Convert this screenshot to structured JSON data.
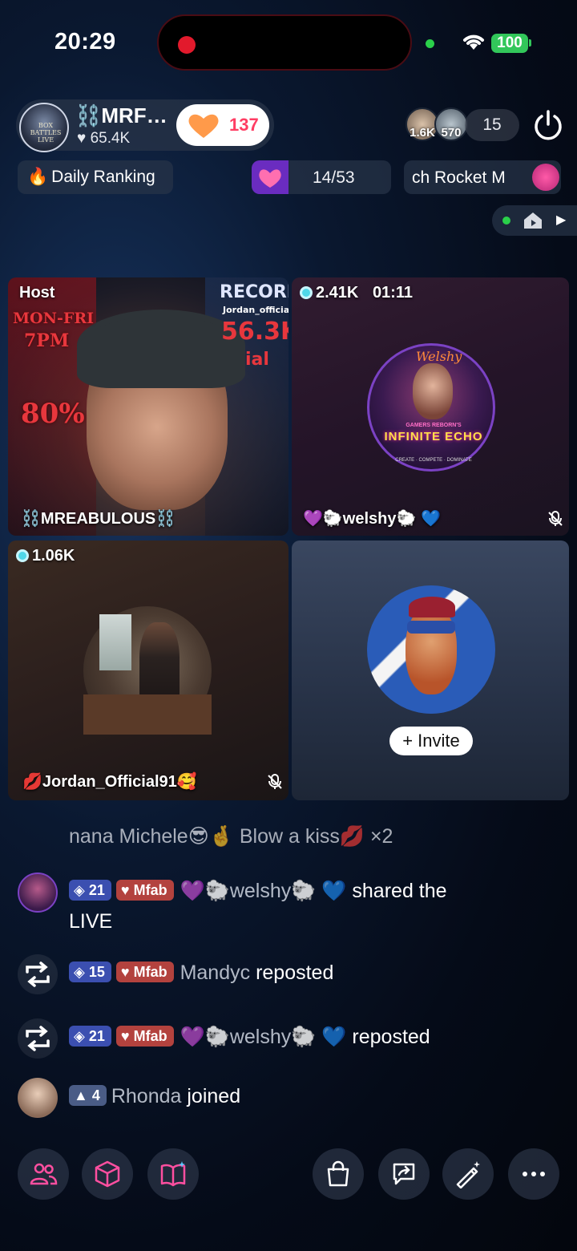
{
  "status_bar": {
    "time": "20:29",
    "battery": "100"
  },
  "host": {
    "name": "⛓️MRF…",
    "likes": "65.4K",
    "heart_count": "137",
    "avatar_text": "BOX BATTLES LIVE"
  },
  "viewers": {
    "avatar1_count": "1.6K",
    "avatar2_count": "570",
    "total": "15"
  },
  "ranking": {
    "label": "Daily Ranking",
    "goal_progress": "14/53",
    "rocket_text": "ch Rocket  M"
  },
  "tiles": {
    "host": {
      "label": "Host",
      "name": "⛓️MREABULOUS⛓️",
      "banner_left": [
        "MON-FRI",
        "7PM",
        "80%"
      ],
      "banner_right": [
        "RECORD",
        "Jordan_official",
        "56.3K",
        "ial"
      ]
    },
    "welshy": {
      "score": "2.41K",
      "timer": "01:11",
      "name": "💜🐑welshy🐑 💙",
      "logo_top": "Welshy",
      "logo_sub": "GAMERS REBORN'S",
      "logo_main": "INFINITE ECHO",
      "logo_tag": "CREATE · COMPETE · DOMINATE"
    },
    "jordan": {
      "score": "1.06K",
      "name": "💋Jordan_Official91🥰"
    },
    "invite": {
      "button": "+ Invite"
    }
  },
  "gift_line": "nana Michele😎🤞  Blow a kiss💋 ×2",
  "comments": [
    {
      "level": "21",
      "fan": "Mfab",
      "name": "💜🐑welshy🐑 💙",
      "action": "shared the",
      "action2": "LIVE"
    },
    {
      "level": "15",
      "fan": "Mfab",
      "name": "Mandyc",
      "action": "reposted"
    },
    {
      "level": "21",
      "fan": "Mfab",
      "name": "💜🐑welshy🐑 💙",
      "action": "reposted"
    },
    {
      "level": "4",
      "name": "Rhonda",
      "action": "joined"
    }
  ],
  "bottom_bar": {
    "icons": [
      "users-icon",
      "cube-icon",
      "book-icon",
      "shopping-bag-icon",
      "share-icon",
      "magic-wand-icon",
      "more-icon"
    ]
  },
  "colors": {
    "accent_pink": "#ff3d63",
    "level_badge": "#3b4fb0",
    "fan_badge": "#b3423e",
    "live_dot": "#e21a2c"
  }
}
